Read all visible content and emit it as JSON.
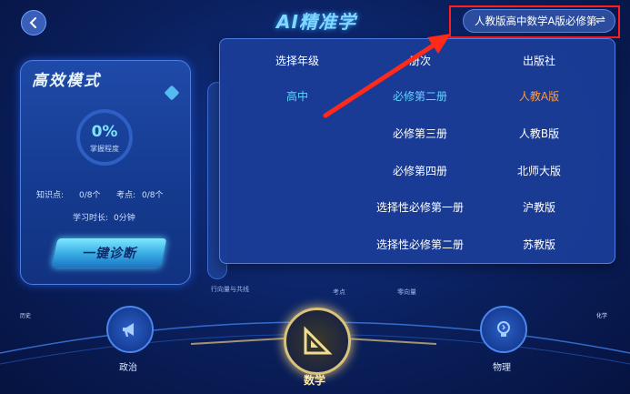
{
  "header": {
    "title": "AI精准学",
    "version_selector": "人教版高中数学A版必修第",
    "swap_symbol": "⇌"
  },
  "card": {
    "title": "高效模式",
    "progress_percent": "0%",
    "progress_label": "掌握程度",
    "knowledge_label": "知识点:",
    "knowledge_value": "0/8个",
    "exam_label": "考点:",
    "exam_value": "0/8个",
    "time_label": "学习时长:",
    "time_value": "0分钟",
    "diagnose_button": "一键诊断"
  },
  "background_hints": {
    "text_1": "行向量与共线",
    "text_2": "考点",
    "text_3": "零向量"
  },
  "dropdown": {
    "headers": [
      "选择年级",
      "册次",
      "出版社"
    ],
    "grades": [
      "高中"
    ],
    "volumes": [
      "必修第二册",
      "必修第三册",
      "必修第四册",
      "选择性必修第一册",
      "选择性必修第二册"
    ],
    "publishers": [
      "人教A版",
      "人教B版",
      "北师大版",
      "沪教版",
      "苏教版"
    ]
  },
  "nav": {
    "left_subject": "政治",
    "center_subject": "数学",
    "right_subject": "物理",
    "left_corner": "历史",
    "right_corner": "化学"
  },
  "colors": {
    "accent": "#5fd6ff",
    "selected_publisher": "#ff9a3a",
    "highlight_box": "#ff1f1f"
  }
}
